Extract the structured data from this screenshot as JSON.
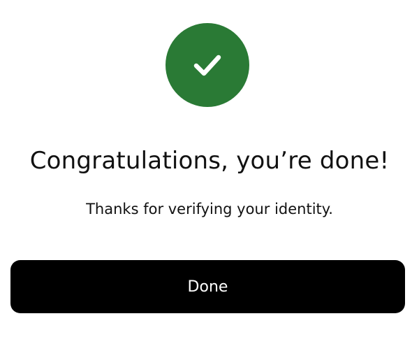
{
  "success_icon": {
    "name": "checkmark-icon",
    "color": "#2a7a35"
  },
  "title": "Congratulations, you’re done!",
  "subtitle": "Thanks for verifying your identity.",
  "done_button": {
    "label": "Done",
    "background": "#000000",
    "text_color": "#ffffff"
  }
}
